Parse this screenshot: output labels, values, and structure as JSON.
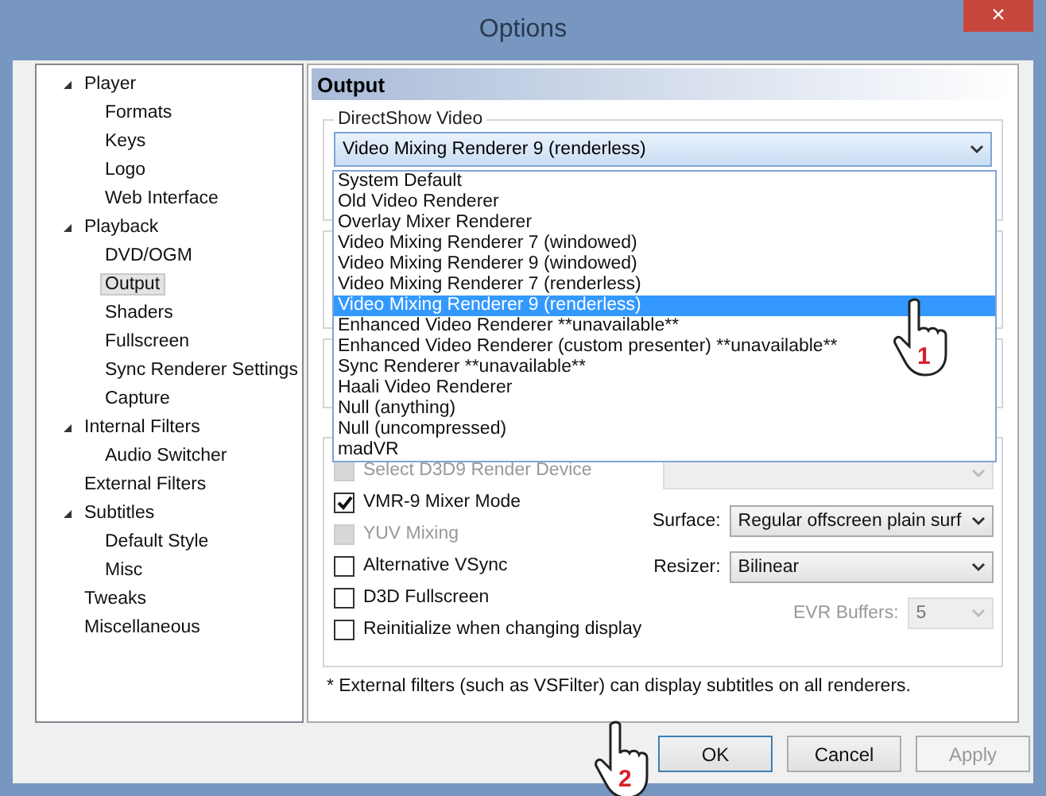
{
  "window": {
    "title": "Options",
    "close": "×"
  },
  "tree": [
    {
      "label": "Player",
      "expanded": true,
      "selected": false,
      "children": [
        {
          "label": "Formats",
          "selected": false
        },
        {
          "label": "Keys",
          "selected": false
        },
        {
          "label": "Logo",
          "selected": false
        },
        {
          "label": "Web Interface",
          "selected": false
        }
      ]
    },
    {
      "label": "Playback",
      "expanded": true,
      "selected": false,
      "children": [
        {
          "label": "DVD/OGM",
          "selected": false
        },
        {
          "label": "Output",
          "selected": true
        },
        {
          "label": "Shaders",
          "selected": false
        },
        {
          "label": "Fullscreen",
          "selected": false
        },
        {
          "label": "Sync Renderer Settings",
          "selected": false
        },
        {
          "label": "Capture",
          "selected": false
        }
      ]
    },
    {
      "label": "Internal Filters",
      "expanded": true,
      "selected": false,
      "children": [
        {
          "label": "Audio Switcher",
          "selected": false
        }
      ]
    },
    {
      "label": "External Filters",
      "selected": false
    },
    {
      "label": "Subtitles",
      "expanded": true,
      "selected": false,
      "children": [
        {
          "label": "Default Style",
          "selected": false
        },
        {
          "label": "Misc",
          "selected": false
        }
      ]
    },
    {
      "label": "Tweaks",
      "selected": false
    },
    {
      "label": "Miscellaneous",
      "selected": false
    }
  ],
  "page_title": "Output",
  "directshow": {
    "legend": "DirectShow Video",
    "value": "Video Mixing Renderer 9 (renderless)",
    "options": [
      {
        "label": "System Default",
        "selected": false
      },
      {
        "label": "Old Video Renderer",
        "selected": false
      },
      {
        "label": "Overlay Mixer Renderer",
        "selected": false
      },
      {
        "label": "Video Mixing Renderer 7 (windowed)",
        "selected": false
      },
      {
        "label": "Video Mixing Renderer 9 (windowed)",
        "selected": false
      },
      {
        "label": "Video Mixing Renderer 7 (renderless)",
        "selected": false
      },
      {
        "label": "Video Mixing Renderer 9 (renderless)",
        "selected": true
      },
      {
        "label": "Enhanced Video Renderer **unavailable**",
        "selected": false
      },
      {
        "label": "Enhanced Video Renderer (custom presenter) **unavailable**",
        "selected": false
      },
      {
        "label": "Sync Renderer **unavailable**",
        "selected": false
      },
      {
        "label": "Haali Video Renderer",
        "selected": false
      },
      {
        "label": "Null (anything)",
        "selected": false
      },
      {
        "label": "Null (uncompressed)",
        "selected": false
      },
      {
        "label": "madVR",
        "selected": false
      }
    ]
  },
  "checkboxes": [
    {
      "label": "Select D3D9 Render Device",
      "checked": false,
      "disabled": true
    },
    {
      "label": "VMR-9 Mixer Mode",
      "checked": true,
      "disabled": false
    },
    {
      "label": "YUV Mixing",
      "checked": false,
      "disabled": true
    },
    {
      "label": "Alternative VSync",
      "checked": false,
      "disabled": false
    },
    {
      "label": "D3D Fullscreen",
      "checked": false,
      "disabled": false
    },
    {
      "label": "Reinitialize when changing display",
      "checked": false,
      "disabled": false
    }
  ],
  "selects": [
    {
      "label": "Surface:",
      "value": "Regular offscreen plain surf",
      "disabled": false
    },
    {
      "label": "Resizer:",
      "value": "Bilinear",
      "disabled": false
    },
    {
      "label": "EVR Buffers:",
      "value": "5",
      "disabled": true
    }
  ],
  "note": "* External filters (such as VSFilter) can display subtitles on all renderers.",
  "buttons": [
    {
      "label": "OK",
      "focused": true,
      "disabled": false
    },
    {
      "label": "Cancel",
      "focused": false,
      "disabled": false
    },
    {
      "label": "Apply",
      "focused": false,
      "disabled": true
    }
  ],
  "callouts": [
    {
      "label": "1"
    },
    {
      "label": "2"
    }
  ]
}
